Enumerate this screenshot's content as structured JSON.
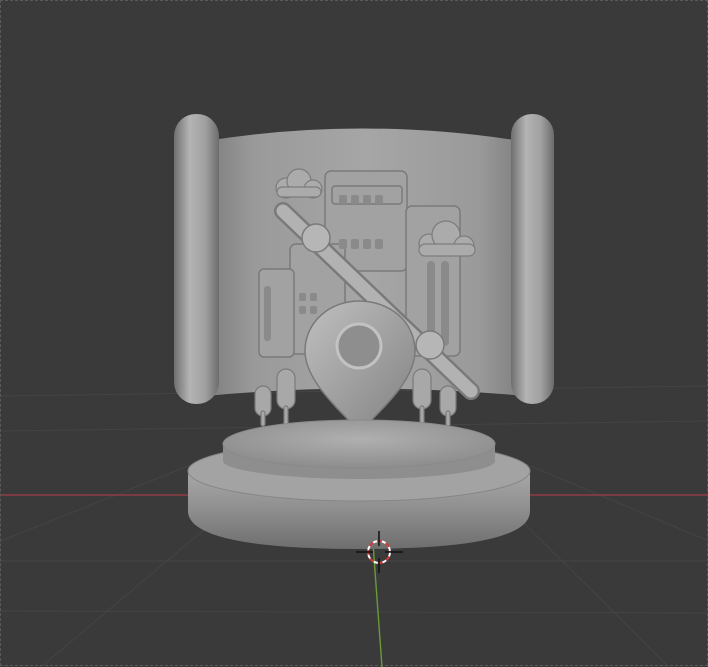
{
  "viewport": {
    "background": "#3a3a3a",
    "grid_color": "#444444",
    "x_axis_color": "#8f3c44",
    "y_axis_color": "#6a9a3a",
    "model_color": "#9c9c9c"
  },
  "icons": {
    "cursor": "3d-cursor-icon"
  }
}
